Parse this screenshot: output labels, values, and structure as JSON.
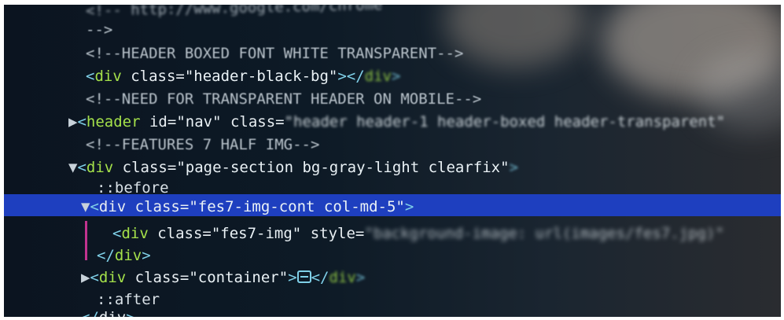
{
  "lines": [
    {
      "text": "<!-- http://www.google.com/chrome"
    },
    {
      "text": "-->"
    },
    {
      "comment": "<!--HEADER BOXED FONT WHITE TRANSPARENT-->"
    },
    {
      "open": "<",
      "tag": "div",
      "attr": " class=",
      "value": "\"header-black-bg\"",
      "close": "></",
      "tag2": "div",
      "end": ">"
    },
    {
      "comment": "<!--NEED FOR TRANSPARENT HEADER ON MOBILE-->"
    },
    {
      "arrow": "▶",
      "open": "<",
      "tag": "header",
      "attr1": " id=",
      "value1": "\"nav\"",
      "attr2": " class=",
      "value2": "\"header header-1 header-boxed header-transparent\""
    },
    {
      "comment": "<!--FEATURES 7 HALF IMG-->"
    },
    {
      "arrow": "▼",
      "open": "<",
      "tag": "div",
      "attr": " class=",
      "value": "\"page-section bg-gray-light clearfix\"",
      "end": ">"
    },
    {
      "pseudo": "::before"
    },
    {
      "arrow": "▼",
      "open": "<",
      "tag": "div",
      "attr": " class=",
      "value": "\"fes7-img-cont col-md-5\"",
      "end": ">"
    },
    {
      "open": "<",
      "tag": "div",
      "attr1": " class=",
      "value1": "\"fes7-img\"",
      "attr2": " style=",
      "value2": "\"background-image: url(images/fes7.jpg)\""
    },
    {
      "open": "</",
      "tag": "div",
      "end": ">"
    },
    {
      "arrow": "▶",
      "open": "<",
      "tag": "div",
      "attr": " class=",
      "value": "\"container\"",
      "close": ">",
      "close2": "</",
      "tag2": "div",
      "end": ">"
    },
    {
      "pseudo": "::after"
    },
    {
      "open": "</",
      "tag": "div",
      "end": ">"
    }
  ],
  "colors": {
    "background": "#0b1420",
    "selection": "#1e3fbf",
    "tag": "#7fd0e8",
    "tagname": "#a4e04a",
    "guide": "#c0338f"
  }
}
